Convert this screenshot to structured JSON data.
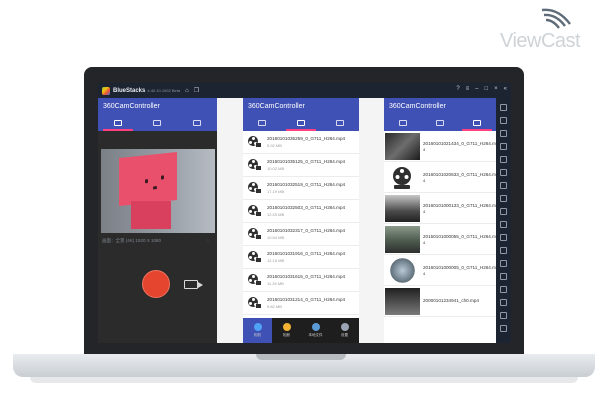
{
  "watermark": {
    "brand": "ViewCast"
  },
  "bluestacks": {
    "name": "BlueStacks",
    "version": "4.40.10.1002 Beta",
    "colors": {
      "bar": "#1c2331"
    },
    "sidebar_icons": [
      "expand-icon",
      "volume-up-icon",
      "volume-down-icon",
      "video-icon",
      "keyboard-icon",
      "fullscreen-icon",
      "rotate-icon",
      "apk-icon",
      "camera-icon",
      "folder-icon",
      "copy-icon",
      "layers-icon",
      "phone-icon",
      "location-icon",
      "shake-icon",
      "settings-icon",
      "back-icon",
      "home-icon"
    ]
  },
  "app": {
    "title": "360CamController",
    "accent": "#3f51b5",
    "tab_indicator": "#ff4081"
  },
  "camera_pane": {
    "info_left": "画面：全景 (4K)  1920 X 1080",
    "info_right": "◌",
    "record_color": "#e5452e"
  },
  "file_list": [
    {
      "name": "20160101035259_0_G711_H264.mp4",
      "size": "5.92 MB"
    },
    {
      "name": "20160101035125_0_G711_H264.mp4",
      "size": "10.02 MB"
    },
    {
      "name": "20160101032519_0_G711_H264.mp4",
      "size": "17.19 MB"
    },
    {
      "name": "20160101032503_0_G711_H264.mp4",
      "size": "12.53 MB"
    },
    {
      "name": "20160101032317_0_G711_H264.mp4",
      "size": "10.54 MB"
    },
    {
      "name": "20160101031916_0_G711_H264.mp4",
      "size": "12.15 MB"
    },
    {
      "name": "20160101031615_0_G711_H264.mp4",
      "size": "11.25 MB"
    },
    {
      "name": "20160101031214_0_G711_H264.mp4",
      "size": "9.82 MB"
    }
  ],
  "bottom_nav": [
    {
      "label": "相机",
      "color": "#4fa3f7"
    },
    {
      "label": "相册",
      "color": "#f2b233"
    },
    {
      "label": "本地文件",
      "color": "#5b9bd5"
    },
    {
      "label": "设置",
      "color": "#9aa4b2"
    }
  ],
  "thumb_list": [
    {
      "name": "20160101021434_0_G711_H264.mp",
      "sub": "4",
      "size": "",
      "thumb": "dark-room"
    },
    {
      "name": "20160101020633_0_G711_H264.mp",
      "sub": "4",
      "size": "",
      "thumb": "film-reel"
    },
    {
      "name": "20160101000133_0_G711_H264.mp",
      "sub": "4",
      "size": "",
      "thumb": "bw-room"
    },
    {
      "name": "20150101000055_0_G711_H264.mp",
      "sub": "4",
      "size": "",
      "thumb": "street"
    },
    {
      "name": "20160101000005_0_G711_H264.mp",
      "sub": "4",
      "size": "",
      "thumb": "fisheye"
    },
    {
      "name": "20000101234941_ch0.mp4",
      "sub": "",
      "size": "",
      "thumb": "dark"
    }
  ]
}
